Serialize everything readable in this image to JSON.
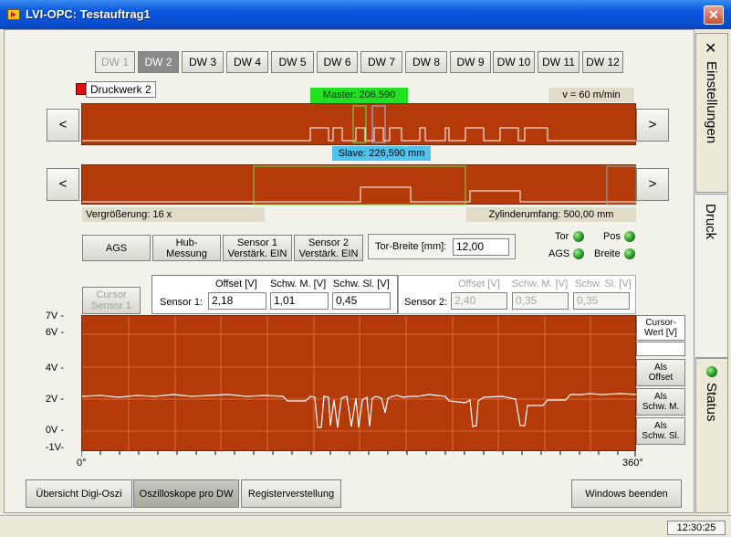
{
  "window": {
    "title": "LVI-OPC: Testauftrag1",
    "close": "✕"
  },
  "dw_tabs": [
    "DW 1",
    "DW 2",
    "DW 3",
    "DW 4",
    "DW 5",
    "DW 6",
    "DW 7",
    "DW 8",
    "DW 9",
    "DW 10",
    "DW 11",
    "DW 12"
  ],
  "printer_label": "Druckwerk 2",
  "strip1": {
    "master": "Master: 206,590 mm",
    "speed": "v = 60 m/min",
    "slave": "Slave: 226,590 mm"
  },
  "strip2": {
    "zoom": "Vergrößerung: 16 x",
    "circumference": "Zylinderumfang: 500,00 mm"
  },
  "nav": {
    "left": "<",
    "right": ">"
  },
  "controls": {
    "ags": "AGS",
    "hub": "Hub-\nMessung",
    "sensor1": "Sensor 1\nVerstärk. EIN",
    "sensor2": "Sensor 2\nVerstärk. EIN",
    "tor_label": "Tor-Breite [mm]:",
    "tor_value": "12,00"
  },
  "leds": {
    "tor": "Tor",
    "pos": "Pos",
    "ags": "AGS",
    "breite": "Breite"
  },
  "sensor_table": {
    "cursor_button": "Cursor\nSensor 1",
    "h_offset": "Offset [V]",
    "h_schw_m": "Schw. M. [V]",
    "h_schw_sl": "Schw. Sl. [V]",
    "s1_label": "Sensor 1:",
    "s1_offset": "2,18",
    "s1_schw_m": "1,01",
    "s1_schw_sl": "0,45",
    "s2_label": "Sensor 2:",
    "s2_offset": "2,40",
    "s2_schw_m": "0,35",
    "s2_schw_sl": "0,35"
  },
  "scope": {
    "y_labels": [
      "7V -",
      "6V -",
      "4V -",
      "2V -",
      "0V -",
      "-1V-"
    ],
    "x_start": "0°",
    "x_end": "360°"
  },
  "side_buttons": {
    "cursor": "Cursor-\nWert [V]",
    "offset": "Als\nOffset",
    "schw_m": "Als\nSchw. M.",
    "schw_sl": "Als\nSchw. Sl."
  },
  "bottom": {
    "digi": "Übersicht Digi-Oszi",
    "oszi": "Oszilloskope pro DW",
    "register": "Registerverstellung",
    "end": "Windows beenden"
  },
  "right_tabs": {
    "settings": "Einstellungen",
    "druck": "Druck",
    "status": "Status"
  },
  "clock": "12:30:25",
  "colors": {
    "strip": "#b53a0a",
    "title_bar": "#0a4fd0"
  }
}
